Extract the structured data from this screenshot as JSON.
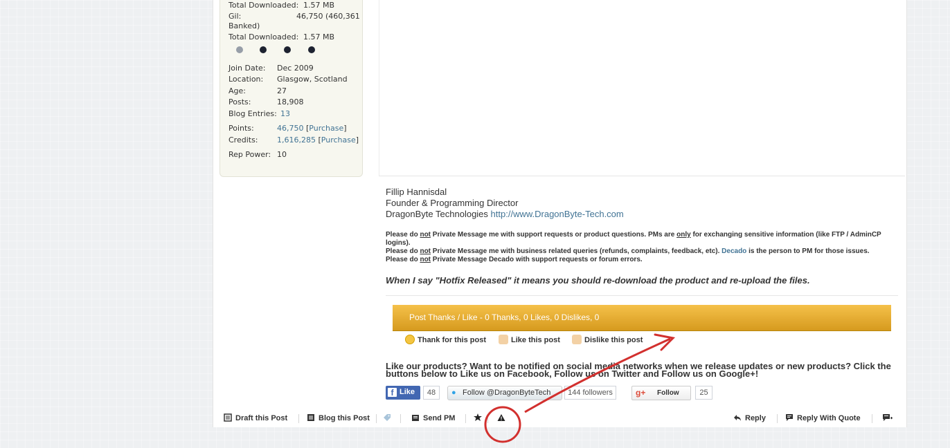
{
  "user_info": {
    "rows": [
      {
        "label": "Total Downloaded:",
        "value": "1.57 MB"
      },
      {
        "label": "Gil:",
        "value": "46,750 (460,361"
      },
      {
        "label": "Banked)",
        "value": ""
      },
      {
        "label": "Total Downloaded:",
        "value": "1.57 MB"
      }
    ],
    "details": [
      {
        "label": "Join Date:",
        "value": "Dec 2009"
      },
      {
        "label": "Location:",
        "value": "Glasgow, Scotland"
      },
      {
        "label": "Age:",
        "value": "27"
      },
      {
        "label": "Posts:",
        "value": "18,908"
      },
      {
        "label": "Blog Entries:",
        "value": "13"
      },
      {
        "label": "Points:",
        "value": "46,750",
        "extra_open": " [",
        "extra_link": "Purchase",
        "extra_close": "]"
      },
      {
        "label": "Credits:",
        "value": "1,616,285",
        "extra_open": " [",
        "extra_link": "Purchase",
        "extra_close": "]"
      },
      {
        "label": "Rep Power:",
        "value": "10"
      }
    ]
  },
  "signature": {
    "name": "Fillip Hannisdal",
    "role": "Founder & Programming Director",
    "company": "DragonByte Technologies",
    "url": "http://www.DragonByte-Tech.com",
    "line1_a": "Please do ",
    "line1_not": "not",
    "line1_b": " Private Message me with support requests or product questions. PMs are ",
    "line1_only": "only",
    "line1_c": " for exchanging sensitive information (like FTP / AdminCP logins).",
    "line2_a": "Please do ",
    "line2_not": "not",
    "line2_b": " Private Message me with business related queries (refunds, complaints, feedback, etc). ",
    "line2_link": "Decado",
    "line2_c": " is the person to PM for those issues.",
    "line3_a": "Please do ",
    "line3_not": "not",
    "line3_b": " Private Message Decado with support requests or forum errors.",
    "quote": "When I say \"Hotfix Released\" it means you should re-download the product and re-upload the files."
  },
  "thanks": {
    "bar_text": "Post Thanks / Like - 0 Thanks, 0 Likes, 0 Dislikes, 0",
    "thank_label": "Thank for this post",
    "like_label": "Like this post",
    "dislike_label": "Dislike this post"
  },
  "social": {
    "text": "Like our products? Want to be notified on social media networks when we release updates or new products? Click the buttons below to Like us on Facebook, Follow us on Twitter and Follow us on Google+!",
    "fb_label": "Like",
    "fb_icon": "f",
    "fb_count": "48",
    "tw_label": "Follow @DragonByteTech",
    "tw_count": "144 followers",
    "gp_label": "Follow",
    "gp_icon": "g+",
    "gp_count": "25"
  },
  "toolbar": {
    "draft": "Draft this Post",
    "blog": "Blog this Post",
    "send_pm": "Send PM",
    "reply": "Reply",
    "reply_quote": "Reply With Quote"
  },
  "colors": {
    "accent": "#d2302e",
    "link": "#417394",
    "bar": "#e0a82e"
  }
}
